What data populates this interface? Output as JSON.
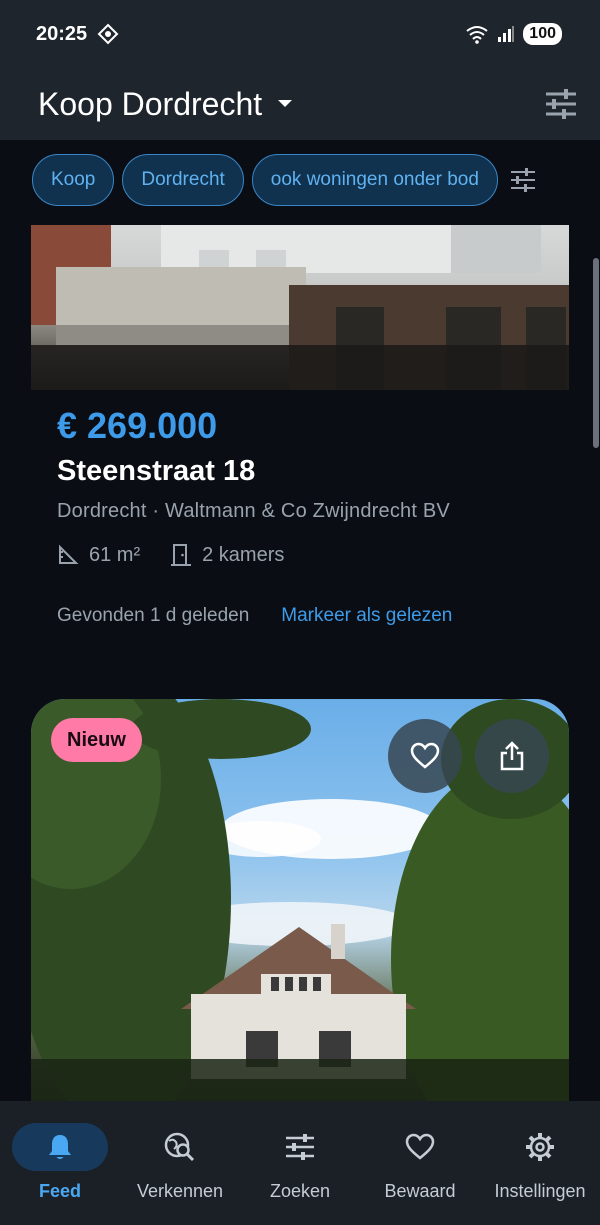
{
  "status_bar": {
    "time": "20:25",
    "battery": "100"
  },
  "app_bar": {
    "title": "Koop Dordrecht"
  },
  "filter_chips": [
    "Koop",
    "Dordrecht",
    "ook woningen onder bod"
  ],
  "listing_1": {
    "price": "€ 269.000",
    "address": "Steenstraat 18",
    "subline": "Dordrecht · Waltmann & Co Zwijndrecht BV",
    "area": "61 m²",
    "rooms": "2 kamers",
    "found": "Gevonden 1 d geleden",
    "mark_read": "Markeer als gelezen"
  },
  "listing_2": {
    "badge": "Nieuw"
  },
  "bottom_nav": [
    {
      "label": "Feed",
      "icon": "bell-icon",
      "active": true
    },
    {
      "label": "Verkennen",
      "icon": "explore-search-icon",
      "active": false
    },
    {
      "label": "Zoeken",
      "icon": "sliders-icon",
      "active": false
    },
    {
      "label": "Bewaard",
      "icon": "heart-icon",
      "active": false
    },
    {
      "label": "Instellingen",
      "icon": "gear-icon",
      "active": false
    }
  ],
  "colors": {
    "accent": "#3d9be9",
    "background": "#0a0e14",
    "badge_new": "#ff7aa6",
    "chip_bg": "#10324f"
  }
}
